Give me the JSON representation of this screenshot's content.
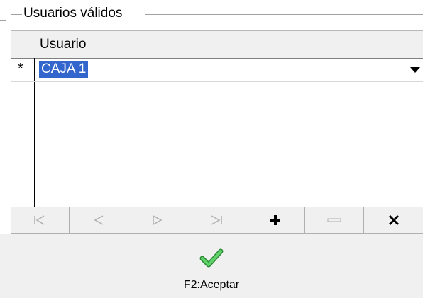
{
  "group": {
    "label": "Usuarios válidos"
  },
  "grid": {
    "columns": [
      "Usuario"
    ],
    "rows": [
      {
        "marker": "*",
        "usuario": "CAJA 1",
        "selected": true
      }
    ]
  },
  "navigator": {
    "buttons": [
      {
        "name": "first-record",
        "icon": "first-record-icon",
        "enabled": false
      },
      {
        "name": "prior-record",
        "icon": "prior-record-icon",
        "enabled": false
      },
      {
        "name": "next-record",
        "icon": "next-record-icon",
        "enabled": false
      },
      {
        "name": "last-record",
        "icon": "last-record-icon",
        "enabled": false
      },
      {
        "name": "insert-record",
        "icon": "plus-icon",
        "enabled": true
      },
      {
        "name": "delete-record",
        "icon": "minus-icon",
        "enabled": false
      },
      {
        "name": "cancel-edit",
        "icon": "x-icon",
        "enabled": true
      }
    ]
  },
  "footer": {
    "accept_label": "F2:Aceptar",
    "accept_icon": "checkmark-icon"
  },
  "colors": {
    "selection": "#3366cc",
    "check": "#3cb043"
  }
}
